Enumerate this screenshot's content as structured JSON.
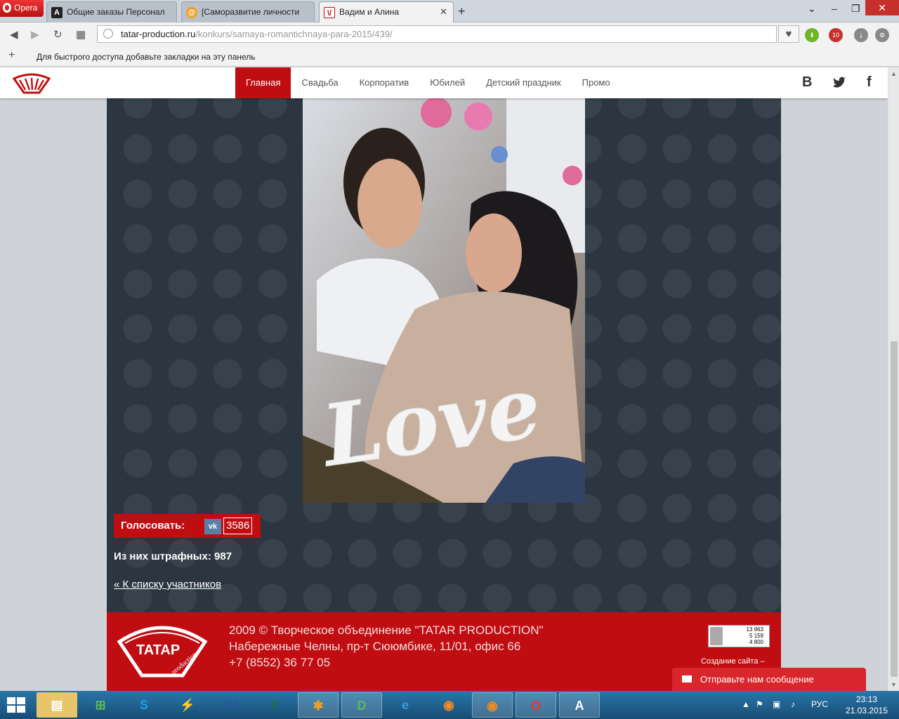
{
  "browser": {
    "menu_label": "Opera",
    "tabs": [
      {
        "title": "Общие заказы Персонал",
        "favicon": "A"
      },
      {
        "title": "[Саморазвитие личности",
        "favicon": "@"
      },
      {
        "title": "Вадим и Алина",
        "favicon": "\\/"
      }
    ],
    "url_host": "tatar-production.ru",
    "url_path": "/konkurs/samaya-romantichnaya-para-2015/439/",
    "bookmarks_hint": "Для быстрого доступа добавьте закладки на эту панель",
    "abp_badge": "10"
  },
  "site": {
    "nav": [
      "Главная",
      "Свадьба",
      "Корпоратив",
      "Юбилей",
      "Детский праздник",
      "Промо"
    ],
    "social": {
      "vk": "B",
      "facebook": "f"
    },
    "photo_caption_text": "Love",
    "vote": {
      "label": "Голосовать:",
      "vk_icon": "vk-icon",
      "count": "3586"
    },
    "penalty": "Из них штрафных: 987",
    "back_link": "« К списку участников",
    "footer": {
      "copyright": "2009 © Творческое объединение \"TATAR PRODUCTION\"",
      "address": "Набережные Челны, пр-т Сююмбике, 11/01, офис 66",
      "phone": "+7 (8552) 36 77 05",
      "counter": [
        "13 963",
        "5 159",
        "4 800"
      ],
      "credit": "Создание сайта –"
    },
    "message_widget": "Отправьте нам сообщение"
  },
  "taskbar": {
    "lang": "РУС",
    "time": "23:13",
    "date": "21.03.2015"
  },
  "colors": {
    "brand_red": "#c00d12",
    "panel_bg": "#2b3641"
  }
}
